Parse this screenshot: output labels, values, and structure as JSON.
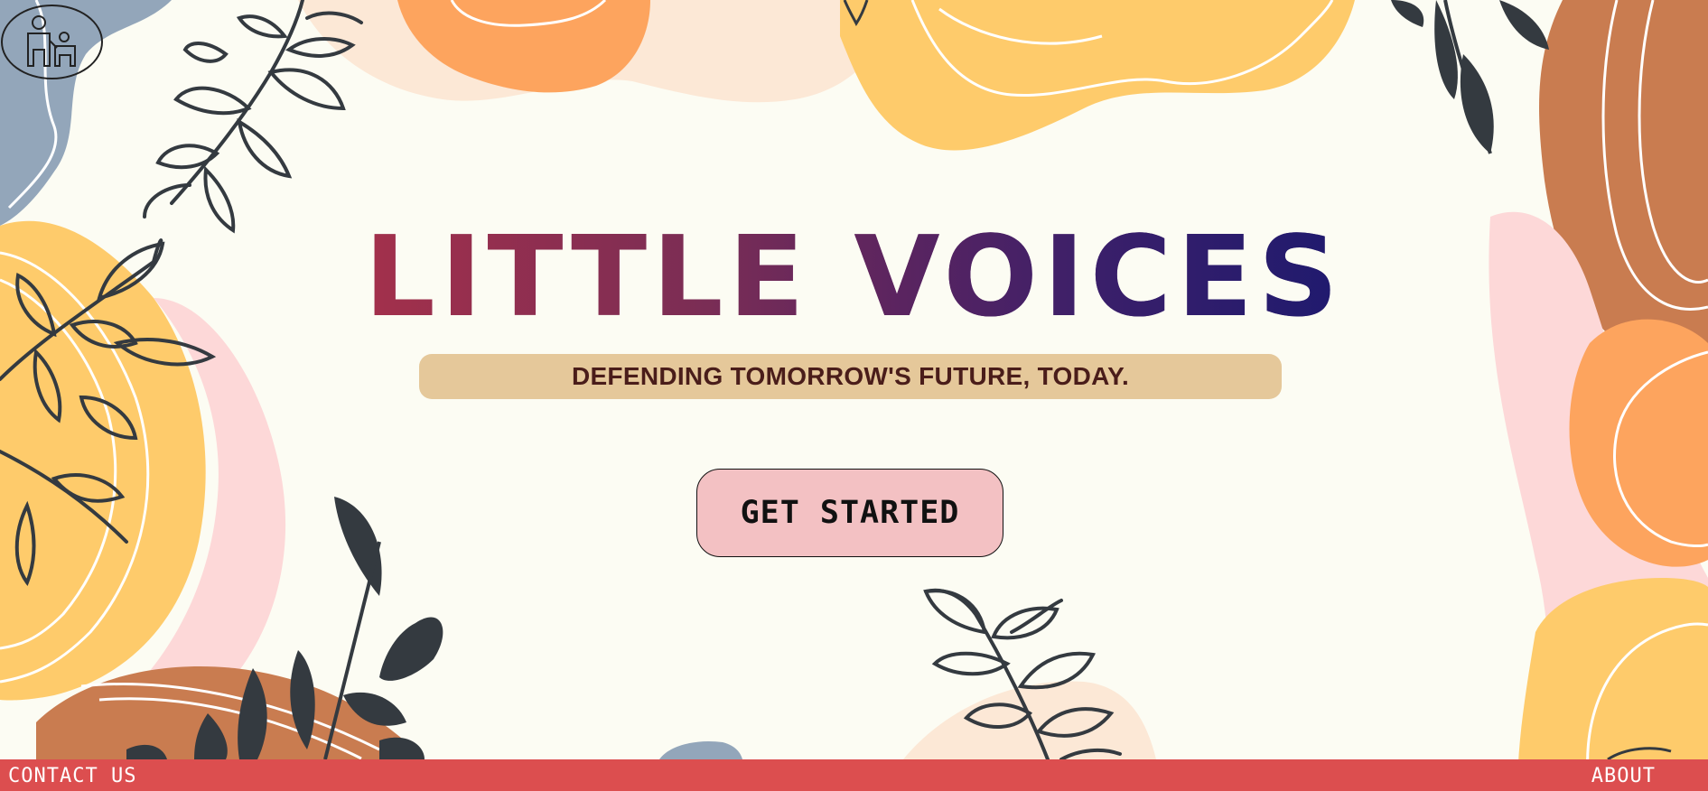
{
  "header": {
    "logo_icon": "parent-and-child-icon"
  },
  "hero": {
    "title": "LITTLE VOICES",
    "tagline": "DEFENDING TOMORROW'S FUTURE, TODAY.",
    "cta_label": "GET STARTED"
  },
  "footer": {
    "contact_label": "CONTACT US",
    "about_label": "ABOUT"
  },
  "colors": {
    "background": "#fcfcf3",
    "title_gradient_start": "#a3304b",
    "title_gradient_end": "#1f1a6e",
    "tagline_bg": "#e5c89a",
    "tagline_text": "#4a1d1a",
    "cta_bg": "#f3c1c3",
    "footer_bg": "#dc4e4f",
    "blob_yellow": "#fecb6b",
    "blob_orange": "#fda45e",
    "blob_pink": "#fdd8d8",
    "blob_brown": "#c97c50",
    "blob_blue": "#93a6ba",
    "leaf_stroke": "#343a40"
  }
}
